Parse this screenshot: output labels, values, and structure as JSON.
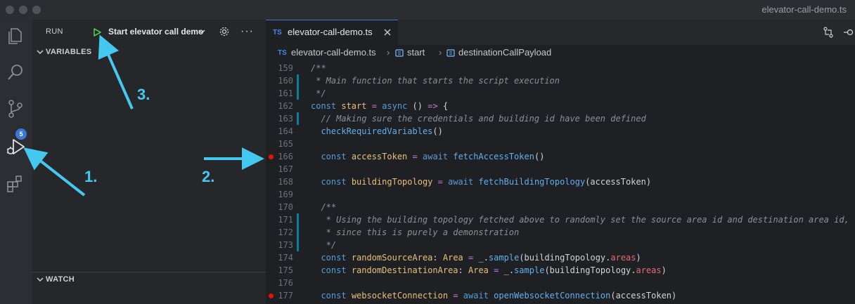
{
  "window": {
    "title": "elevator-call-demo.ts"
  },
  "activity_bar": {
    "icons": [
      "files-icon",
      "search-icon",
      "source-control-icon",
      "run-debug-icon",
      "extensions-icon"
    ],
    "scm_badge": "5"
  },
  "sidebar": {
    "run_label": "RUN",
    "config_name": "Start elevator call demo",
    "variables_label": "VARIABLES",
    "watch_label": "WATCH"
  },
  "editor": {
    "tab": {
      "lang": "TS",
      "label": "elevator-call-demo.ts"
    },
    "breadcrumb": {
      "lang": "TS",
      "file": "elevator-call-demo.ts",
      "symbol1": "start",
      "symbol2": "destinationCallPayload"
    },
    "lines": [
      {
        "n": "159",
        "code": "/**"
      },
      {
        "n": "160",
        "code": " * Main function that starts the script execution"
      },
      {
        "n": "161",
        "code": " */"
      },
      {
        "n": "162",
        "code": "const start = async () => {"
      },
      {
        "n": "163",
        "code": "  // Making sure the credentials and building id have been defined"
      },
      {
        "n": "164",
        "code": "  checkRequiredVariables()"
      },
      {
        "n": "165",
        "code": ""
      },
      {
        "n": "166",
        "code": "  const accessToken = await fetchAccessToken()"
      },
      {
        "n": "167",
        "code": ""
      },
      {
        "n": "168",
        "code": "  const buildingTopology = await fetchBuildingTopology(accessToken)"
      },
      {
        "n": "169",
        "code": ""
      },
      {
        "n": "170",
        "code": "  /**"
      },
      {
        "n": "171",
        "code": "   * Using the building topology fetched above to randomly set the source area id and destination area id,"
      },
      {
        "n": "172",
        "code": "   * since this is purely a demonstration"
      },
      {
        "n": "173",
        "code": "   */"
      },
      {
        "n": "174",
        "code": "  const randomSourceArea: Area = _.sample(buildingTopology.areas)"
      },
      {
        "n": "175",
        "code": "  const randomDestinationArea: Area = _.sample(buildingTopology.areas)"
      },
      {
        "n": "176",
        "code": ""
      },
      {
        "n": "177",
        "code": "  const websocketConnection = await openWebsocketConnection(accessToken)"
      }
    ]
  },
  "annotations": {
    "a1": "1.",
    "a2": "2.",
    "a3": "3."
  },
  "colors": {
    "accent": "#45c8ef",
    "breakpoint": "#e51400",
    "badge": "#3a78d4"
  }
}
